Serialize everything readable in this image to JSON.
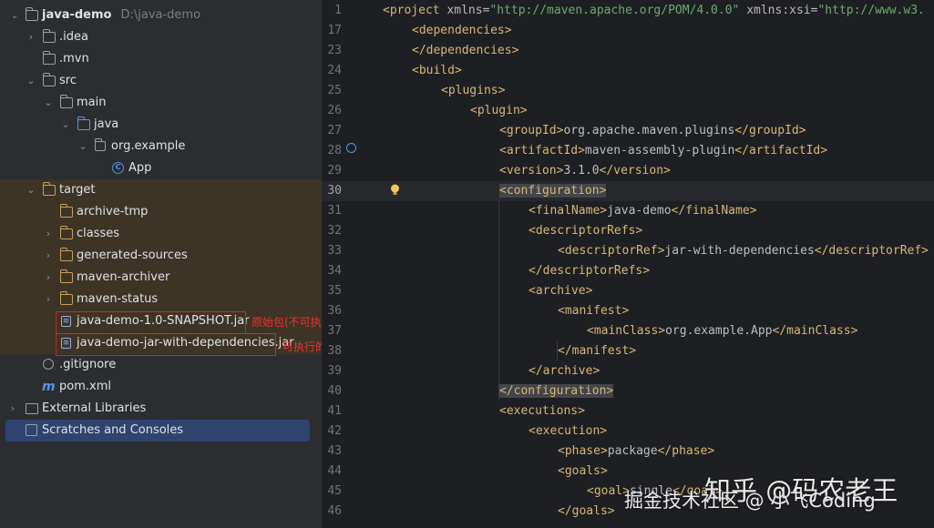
{
  "project_tree": {
    "root": {
      "name": "java-demo",
      "path": "D:\\java-demo"
    },
    "items": [
      {
        "label": ".idea"
      },
      {
        "label": ".mvn"
      },
      {
        "label": "src"
      },
      {
        "label": "main"
      },
      {
        "label": "java"
      },
      {
        "label": "org.example"
      },
      {
        "label": "App"
      },
      {
        "label": "target"
      },
      {
        "label": "archive-tmp"
      },
      {
        "label": "classes"
      },
      {
        "label": "generated-sources"
      },
      {
        "label": "maven-archiver"
      },
      {
        "label": "maven-status"
      },
      {
        "label": "java-demo-1.0-SNAPSHOT.jar"
      },
      {
        "label": "java-demo-jar-with-dependencies.jar"
      },
      {
        "label": ".gitignore"
      },
      {
        "label": "pom.xml"
      },
      {
        "label": "External Libraries"
      },
      {
        "label": "Scratches and Consoles"
      }
    ],
    "annotations": {
      "snapshot_jar": "原始包(不可执行)",
      "fat_jar": "可执行的fat包"
    }
  },
  "editor": {
    "lines": [
      {
        "num": "1",
        "pre": "",
        "tag_open": "<project",
        "attrs": " xmlns=\"http://maven.apache.org/POM/4.0.0\" xmlns:xsi=\"http://www.w3."
      },
      {
        "num": "17",
        "text": "<dependencies>"
      },
      {
        "num": "23",
        "text": "</dependencies>"
      },
      {
        "num": "24",
        "text": "<build>"
      },
      {
        "num": "25",
        "text": "<plugins>"
      },
      {
        "num": "26",
        "text": "<plugin>"
      },
      {
        "num": "27",
        "open": "<groupId>",
        "value": "org.apache.maven.plugins",
        "close": "</groupId>"
      },
      {
        "num": "28",
        "open": "<artifactId>",
        "value": "maven-assembly-plugin",
        "close": "</artifactId>"
      },
      {
        "num": "29",
        "open": "<version>",
        "value": "3.1.0",
        "close": "</version>"
      },
      {
        "num": "30",
        "text": "<configuration>"
      },
      {
        "num": "31",
        "open": "<finalName>",
        "value": "java-demo",
        "close": "</finalName>"
      },
      {
        "num": "32",
        "text": "<descriptorRefs>"
      },
      {
        "num": "33",
        "open": "<descriptorRef>",
        "value": "jar-with-dependencies",
        "close": "</descriptorRef>"
      },
      {
        "num": "34",
        "text": "</descriptorRefs>"
      },
      {
        "num": "35",
        "text": "<archive>"
      },
      {
        "num": "36",
        "text": "<manifest>"
      },
      {
        "num": "37",
        "open": "<mainClass>",
        "value": "org.example.App",
        "close": "</mainClass>"
      },
      {
        "num": "38",
        "text": "</manifest>"
      },
      {
        "num": "39",
        "text": "</archive>"
      },
      {
        "num": "40",
        "text": "</configuration>"
      },
      {
        "num": "41",
        "text": "<executions>"
      },
      {
        "num": "42",
        "text": "<execution>"
      },
      {
        "num": "43",
        "open": "<phase>",
        "value": "package",
        "close": "</phase>"
      },
      {
        "num": "44",
        "text": "<goals>"
      },
      {
        "num": "45",
        "open": "<goal>",
        "value": "single",
        "close": "</goal>"
      },
      {
        "num": "46",
        "text": "</goals>"
      }
    ]
  },
  "watermark": {
    "primary": "知乎 @码农老王",
    "secondary": "掘金技术社区 @ 小飞Coding"
  },
  "colors": {
    "tree_bg": "#2b2d30",
    "editor_bg": "#1e1f22",
    "tag": "#d5b778",
    "attr_value": "#6aab73",
    "annotation_red": "#e02020",
    "selection": "#2e436e",
    "excluded": "#3d3426"
  }
}
